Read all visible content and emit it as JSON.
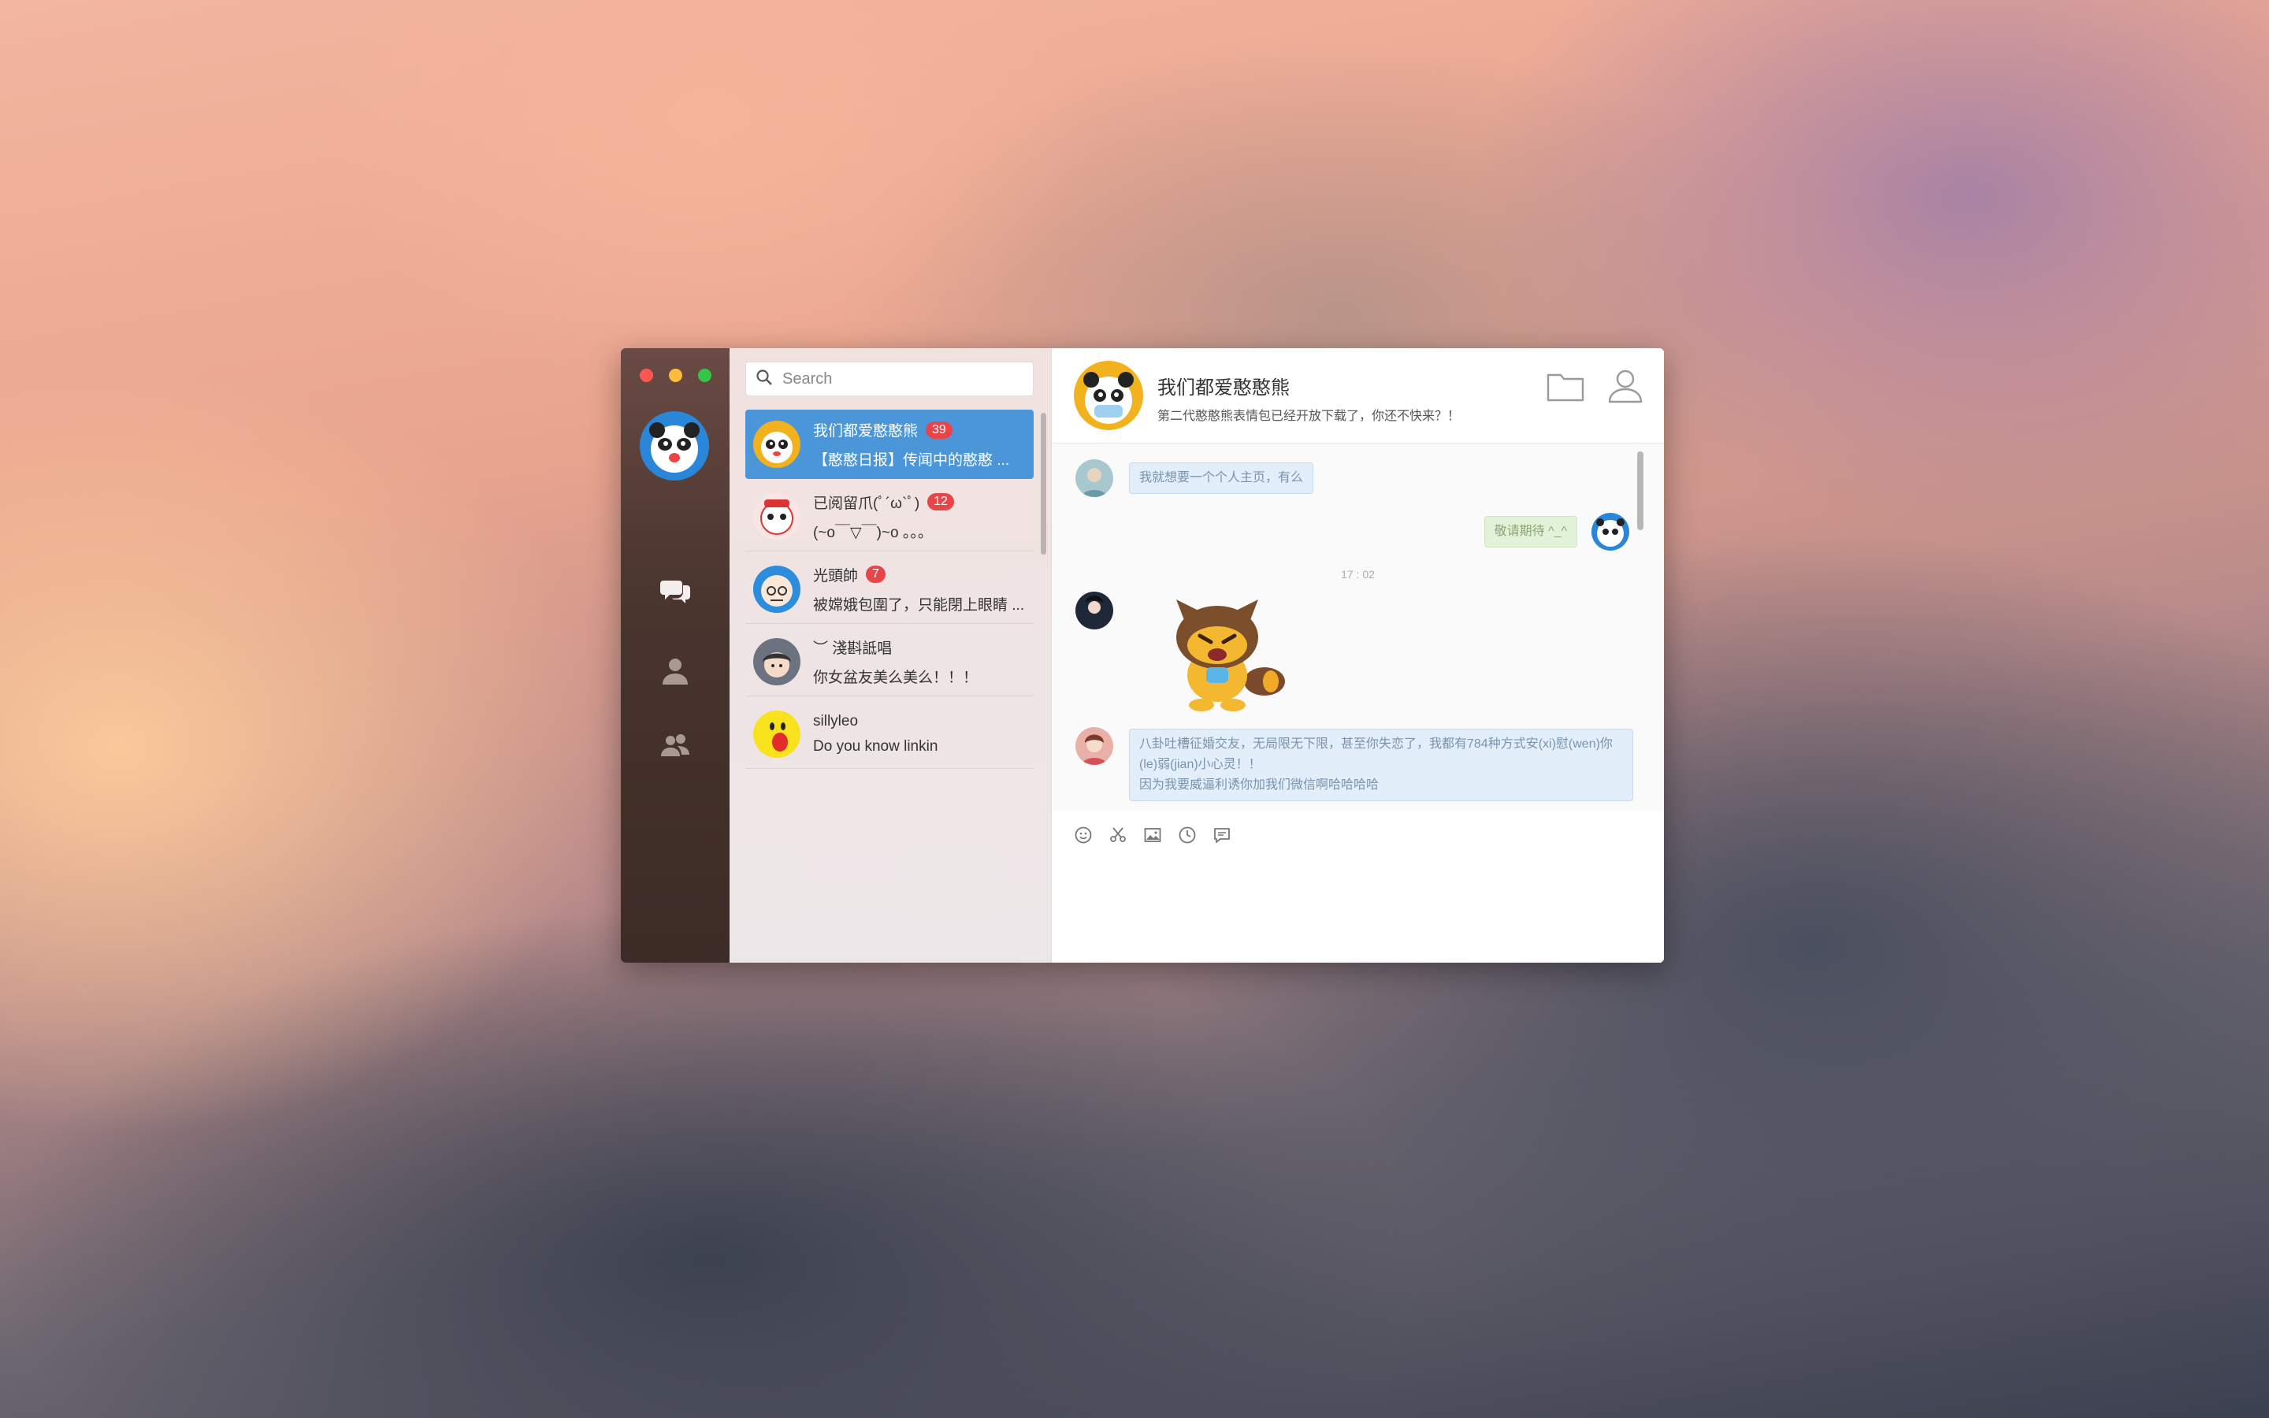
{
  "window": {
    "traffic_lights": [
      "close",
      "minimize",
      "maximize"
    ],
    "colors": {
      "close": "#fc5753",
      "minimize": "#fdbc40",
      "maximize": "#33c748",
      "accent": "#4a96d8",
      "badge": "#e8454a"
    }
  },
  "sidebar": {
    "icons": [
      "chat-icon",
      "contacts-icon",
      "groups-icon",
      "more-icon"
    ]
  },
  "search": {
    "placeholder": "Search"
  },
  "conversations": [
    {
      "name": "我们都爱憨憨熊",
      "badge": "39",
      "message": "【憨憨日报】传闻中的憨憨 ...",
      "active": true
    },
    {
      "name": "已阅留爪(ﾟ´ω`ﾟ)",
      "badge": "12",
      "message": "(~o￣▽￣)~o 。。。"
    },
    {
      "name": "光頭帥",
      "badge": "7",
      "message": "被嫦娥包圍了，只能閉上眼睛 ..."
    },
    {
      "name": "︶ 淺斟詆唱",
      "badge": "",
      "message": "你女盆友美么美么！！！"
    },
    {
      "name": "sillyleo",
      "badge": "",
      "message": "Do you know linkin"
    }
  ],
  "chat": {
    "title": "我们都爱憨憨熊",
    "subtitle": "第二代憨憨熊表情包已经开放下载了，你还不快来？！",
    "messages": [
      {
        "text": "我就想要一个个人主页，有么",
        "mine": false
      },
      {
        "text": "敬请期待 ^_^",
        "mine": true
      },
      {
        "text": "八卦吐槽征婚交友，无局限无下限，甚至你失恋了，我都有784种方式安(xi)慰(wen)你(le)弱(jian)小心灵！！",
        "mine": false
      },
      {
        "text": "因为我要威逼利诱你加我们微信啊哈哈哈哈",
        "mine": false
      }
    ],
    "timestamp": "17 : 02",
    "toolbar": [
      "emoji-icon",
      "scissors-icon",
      "image-icon",
      "clock-icon",
      "comment-icon"
    ]
  }
}
